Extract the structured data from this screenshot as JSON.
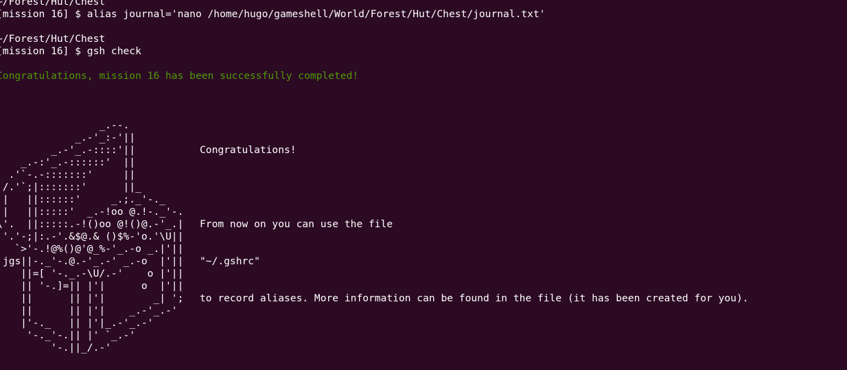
{
  "session": [
    {
      "text": "~/Forest/Hut/Chest",
      "kind": "path"
    },
    {
      "text": "[mission 16] $ alias journal='nano /home/hugo/gameshell/World/Forest/Hut/Chest/journal.txt'",
      "kind": "command"
    },
    {
      "text": "",
      "kind": "blank"
    },
    {
      "text": "~/Forest/Hut/Chest",
      "kind": "path"
    },
    {
      "text": "[mission 16] $ gsh check",
      "kind": "command"
    },
    {
      "text": "",
      "kind": "blank"
    },
    {
      "text": "Congratulations, mission 16 has been successfully completed!",
      "kind": "success"
    }
  ],
  "message": {
    "title": "Congratulations!",
    "blank": "",
    "line1": "From now on you can use the file",
    "line2": "\"~/.gshrc\"",
    "line3": "to record aliases. More information can be found in the file (it has been created for you)."
  },
  "ascii_art": "                 _.--.\n             _.-'_:-'||\n         _.-'_.-::::'||\n    _.-:'_.-::::::'  ||\n  .'`-.-:::::::'     ||\n /.'`;|:::::::'      ||_\n||   ||::::::'     _.;._'-._\n||   ||:::::'  _.-!oo @.!-._'-.\n\\'.  ||:::::.-!()oo @!()@.-'_.|\n '.'-;|:.-'.&$@.& ()$%-'o.'\\U||\n   `>'-.!@%()@'@_%-'_.-o _.|'||\n    ||-._'-.@.-'_.-' _.-o  |'||\n    ||=[ '-._.-\\U/.-'    o |'||\n    || '-.]=|| |'|      o  |'||\n    ||      || |'|        _| ';\n    ||      || |'|    _.-'_.-'\n    |'-._   || |'|_.-'_.-'\n     '-._'-.|| |' `_.-'\n         '-.||_/.-'",
  "signature": "jgs",
  "colors": {
    "background": "#2c0a24",
    "foreground": "#ffffff",
    "success": "#4e9a06"
  }
}
